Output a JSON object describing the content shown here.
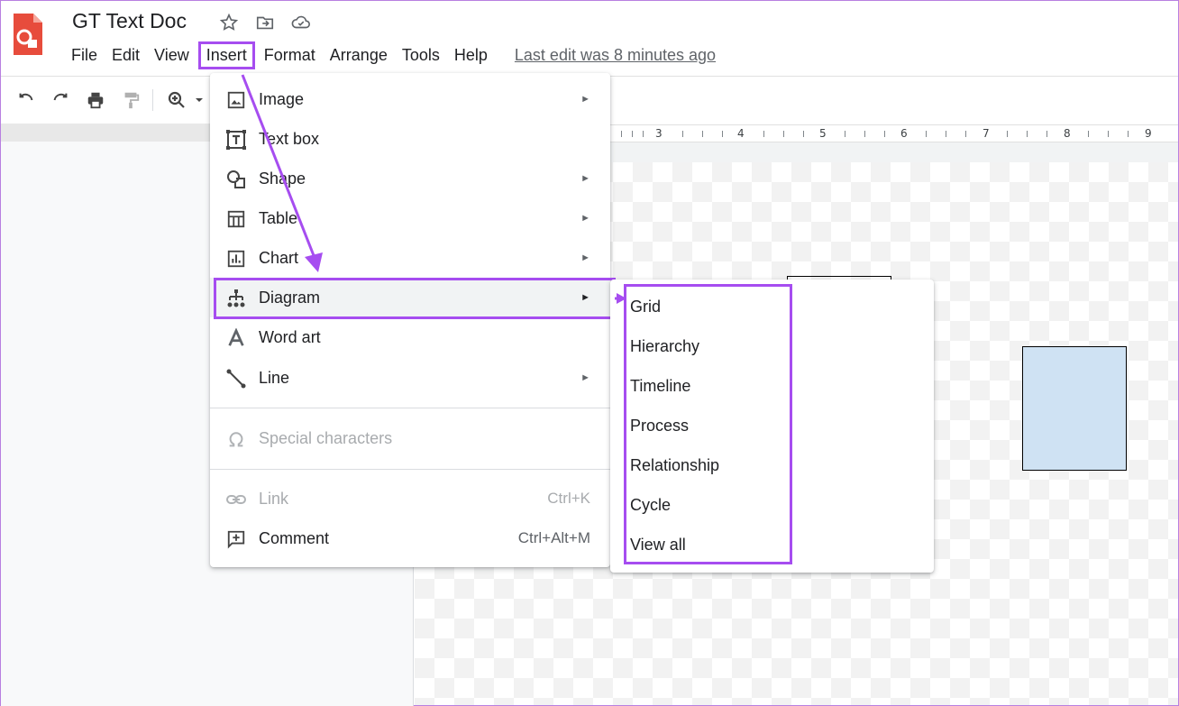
{
  "header": {
    "doc_title": "GT Text Doc",
    "last_edit": "Last edit was 8 minutes ago"
  },
  "menubar": {
    "items": [
      "File",
      "Edit",
      "View",
      "Insert",
      "Format",
      "Arrange",
      "Tools",
      "Help"
    ],
    "active": "Insert"
  },
  "toolbar": {
    "icons": [
      "undo-icon",
      "redo-icon",
      "print-icon",
      "paint-format-icon",
      "zoom-icon",
      "dropdown-icon"
    ]
  },
  "ruler": {
    "labels": [
      "3",
      "4",
      "5",
      "6",
      "7",
      "8",
      "9"
    ]
  },
  "insert_menu": {
    "items": [
      {
        "label": "Image",
        "icon": "image-icon",
        "submenu": true
      },
      {
        "label": "Text box",
        "icon": "text-box-icon",
        "submenu": false
      },
      {
        "label": "Shape",
        "icon": "shape-icon",
        "submenu": true
      },
      {
        "label": "Table",
        "icon": "table-icon",
        "submenu": true
      },
      {
        "label": "Chart",
        "icon": "chart-icon",
        "submenu": true
      },
      {
        "label": "Diagram",
        "icon": "diagram-icon",
        "submenu": true,
        "highlighted": true
      },
      {
        "label": "Word art",
        "icon": "word-art-icon",
        "submenu": false
      },
      {
        "label": "Line",
        "icon": "line-icon",
        "submenu": true
      },
      {
        "label": "Special characters",
        "icon": "omega-icon",
        "disabled": true
      },
      {
        "label": "Link",
        "icon": "link-icon",
        "shortcut": "Ctrl+K",
        "disabled": true
      },
      {
        "label": "Comment",
        "icon": "comment-icon",
        "shortcut": "Ctrl+Alt+M"
      }
    ],
    "arrow_glyph": "►"
  },
  "diagram_submenu": {
    "items": [
      "Grid",
      "Hierarchy",
      "Timeline",
      "Process",
      "Relationship",
      "Cycle",
      "View all"
    ]
  },
  "colors": {
    "annotation": "#a64df0",
    "app_logo": "#e74c3c",
    "shape_fill": "#cfe2f3"
  }
}
